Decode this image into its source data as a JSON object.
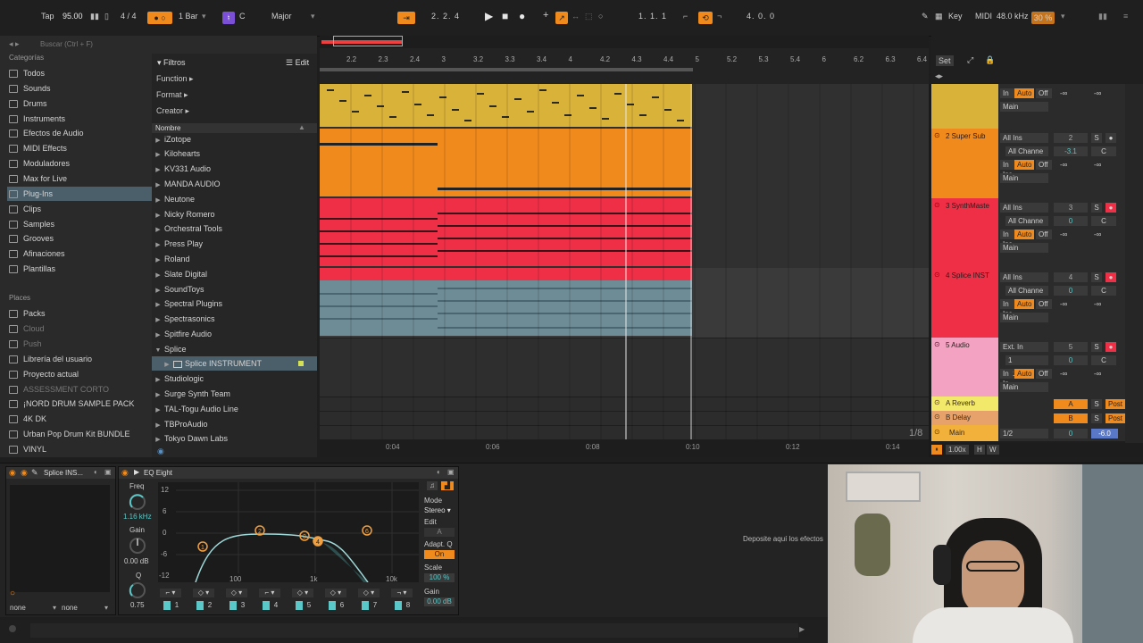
{
  "transport": {
    "tap": "Tap",
    "tempo": "95.00",
    "signature": "4 / 4",
    "quantize": "1 Bar",
    "key": "C",
    "scale": "Major",
    "position": "2. 2. 4",
    "loop_start": "1. 1. 1",
    "loop_length": "4. 0. 0",
    "key_label": "Key",
    "midi_label": "MIDI",
    "sample_rate": "48.0 kHz",
    "cpu": "30 %"
  },
  "browser": {
    "search_placeholder": "Buscar (Ctrl + F)",
    "categories_title": "Categorías",
    "categories": [
      "Todos",
      "Sounds",
      "Drums",
      "Instruments",
      "Efectos de Audio",
      "MIDI Effects",
      "Moduladores",
      "Max for Live",
      "Plug-Ins",
      "Clips",
      "Samples",
      "Grooves",
      "Afinaciones",
      "Plantillas"
    ],
    "places_title": "Places",
    "places": [
      "Packs",
      "Cloud",
      "Push",
      "Librería del usuario",
      "Proyecto actual",
      "ASSESSMENT CORTO",
      "¡NORD DRUM SAMPLE PACK",
      "4K DK",
      "Urban Pop Drum Kit BUNDLE",
      "VINYL"
    ],
    "filters_label": "Filtros",
    "edit_label": "Edit",
    "filter_rows": [
      "Function ▸",
      "Format ▸",
      "Creator ▸"
    ],
    "name_header": "Nombre",
    "items": [
      "iZotope",
      "Kilohearts",
      "KV331 Audio",
      "MANDA AUDIO",
      "Neutone",
      "Nicky Romero",
      "Orchestral Tools",
      "Press Play",
      "Roland",
      "Slate Digital",
      "SoundToys",
      "Spectral Plugins",
      "Spectrasonics",
      "Spitfire Audio",
      "Splice",
      "Splice INSTRUMENT",
      "Studiologic",
      "Surge Synth Team",
      "TAL-Togu Audio Line",
      "TBProAudio",
      "Tokyo Dawn Labs"
    ]
  },
  "ruler": {
    "bars": [
      "2.2",
      "2.3",
      "2.4",
      "3",
      "3.2",
      "3.3",
      "3.4",
      "4",
      "4.2",
      "4.3",
      "4.4",
      "5",
      "5.2",
      "5.3",
      "5.4",
      "6",
      "6.2",
      "6.3",
      "6.4"
    ],
    "times": [
      "0:04",
      "0:06",
      "0:08",
      "0:10",
      "0:12",
      "0:14"
    ],
    "set_label": "Set",
    "grid": "1/8"
  },
  "tracks": [
    {
      "name": "",
      "color": "#d9b23a",
      "input": "In",
      "auto": "Auto",
      "off": "Off",
      "out": "Main",
      "num": ""
    },
    {
      "name": "2 Super Sub",
      "color": "#f08a1c",
      "input": "All Ins",
      "channel": "All Channe",
      "auto": "Auto",
      "off": "Off",
      "out": "Main",
      "num": "2",
      "vol": "-3.1"
    },
    {
      "name": "3 SynthMaste",
      "color": "#ee2f46",
      "input": "All Ins",
      "channel": "All Channe",
      "auto": "Auto",
      "off": "Off",
      "out": "Main",
      "num": "3",
      "vol": "0"
    },
    {
      "name": "4 Splice INST",
      "color": "#ee2f46",
      "input": "All Ins",
      "channel": "All Channe",
      "auto": "Auto",
      "off": "Off",
      "out": "Main",
      "num": "4",
      "vol": "0"
    },
    {
      "name": "5 Audio",
      "color": "#f4a2c2",
      "input": "Ext. In",
      "channel": "1",
      "auto": "Auto",
      "off": "Off",
      "out": "Main",
      "num": "5",
      "vol": "0"
    }
  ],
  "returns": [
    {
      "name": "A Reverb",
      "color": "#f2e96a",
      "letter": "A",
      "post": "Post"
    },
    {
      "name": "B Delay",
      "color": "#e6a26a",
      "letter": "B",
      "post": "Post"
    }
  ],
  "master": {
    "name": "Main",
    "cue": "1/2",
    "vol": "0",
    "db": "-6.0"
  },
  "mixer_common": {
    "minus_inf": "-∞",
    "solo": "S",
    "center": "C",
    "zoom": "1.00x",
    "h": "H",
    "w": "W"
  },
  "device_chain": {
    "instrument_name": "Splice INS...",
    "selector_left": "none",
    "selector_right": "none",
    "eq_name": "EQ Eight",
    "freq_label": "Freq",
    "freq_value": "1.16 kHz",
    "gain_label": "Gain",
    "gain_value": "0.00 dB",
    "q_label": "Q",
    "q_value": "0.75",
    "db_ticks": [
      "12",
      "6",
      "0",
      "-6",
      "-12"
    ],
    "freq_ticks": [
      "100",
      "1k",
      "10k"
    ],
    "mode_label": "Mode",
    "mode_value": "Stereo",
    "edit_label": "Edit",
    "edit_value": "A",
    "adapt_label": "Adapt. Q",
    "adapt_value": "On",
    "scale_label": "Scale",
    "scale_value": "100 %",
    "gain2_label": "Gain",
    "gain2_value": "0.00 dB",
    "bands": [
      "1",
      "2",
      "3",
      "4",
      "5",
      "6",
      "7",
      "8"
    ],
    "drop_hint": "Deposite aquí los efectos"
  }
}
